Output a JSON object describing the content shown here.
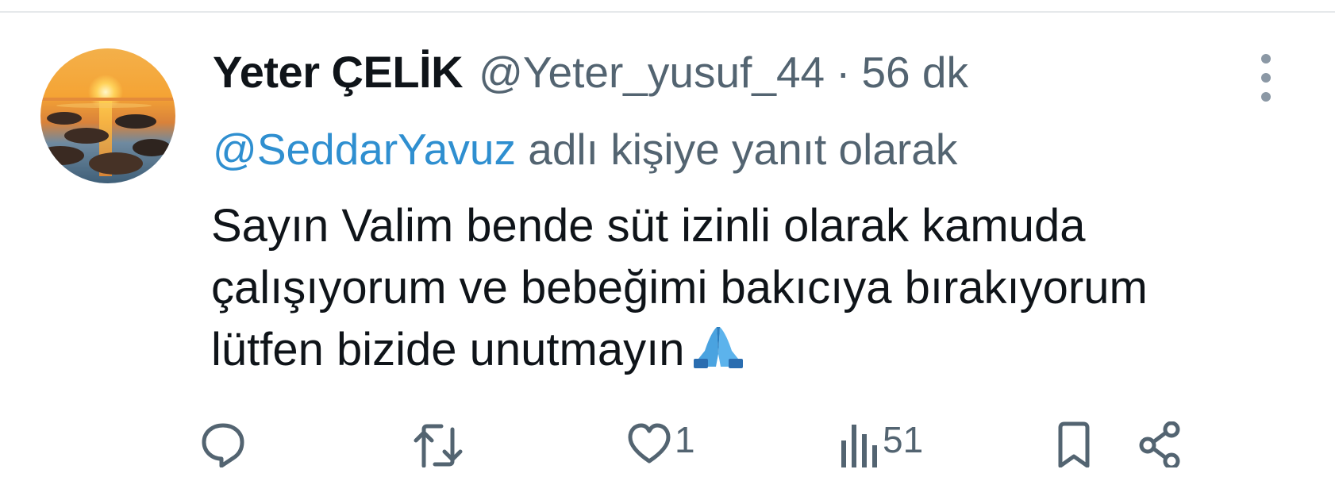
{
  "tweet": {
    "display_name": "Yeter ÇELİK",
    "handle": "@Yeter_yusuf_44",
    "separator": "·",
    "time": "56 dk",
    "reply_to": {
      "mention": "@SeddarYavuz",
      "suffix": " adlı kişiye yanıt olarak"
    },
    "text_lines": [
      "Sayın Valim bende süt izinli olarak kamuda",
      "çalışıyorum ve bebeğimi bakıcıya bırakıyorum",
      "lütfen bizide unutmayın"
    ],
    "emoji": "folded-hands-emoji"
  },
  "actions": {
    "reply": {
      "icon": "reply-icon"
    },
    "retweet": {
      "icon": "retweet-icon"
    },
    "like": {
      "icon": "heart-icon",
      "count": "1"
    },
    "views": {
      "icon": "views-icon",
      "count": "51"
    },
    "bookmark": {
      "icon": "bookmark-icon"
    },
    "share": {
      "icon": "share-icon"
    }
  },
  "colors": {
    "text": "#0f1419",
    "secondary": "#536471",
    "link": "#2f8fd0",
    "divider": "#e6e9eb"
  }
}
